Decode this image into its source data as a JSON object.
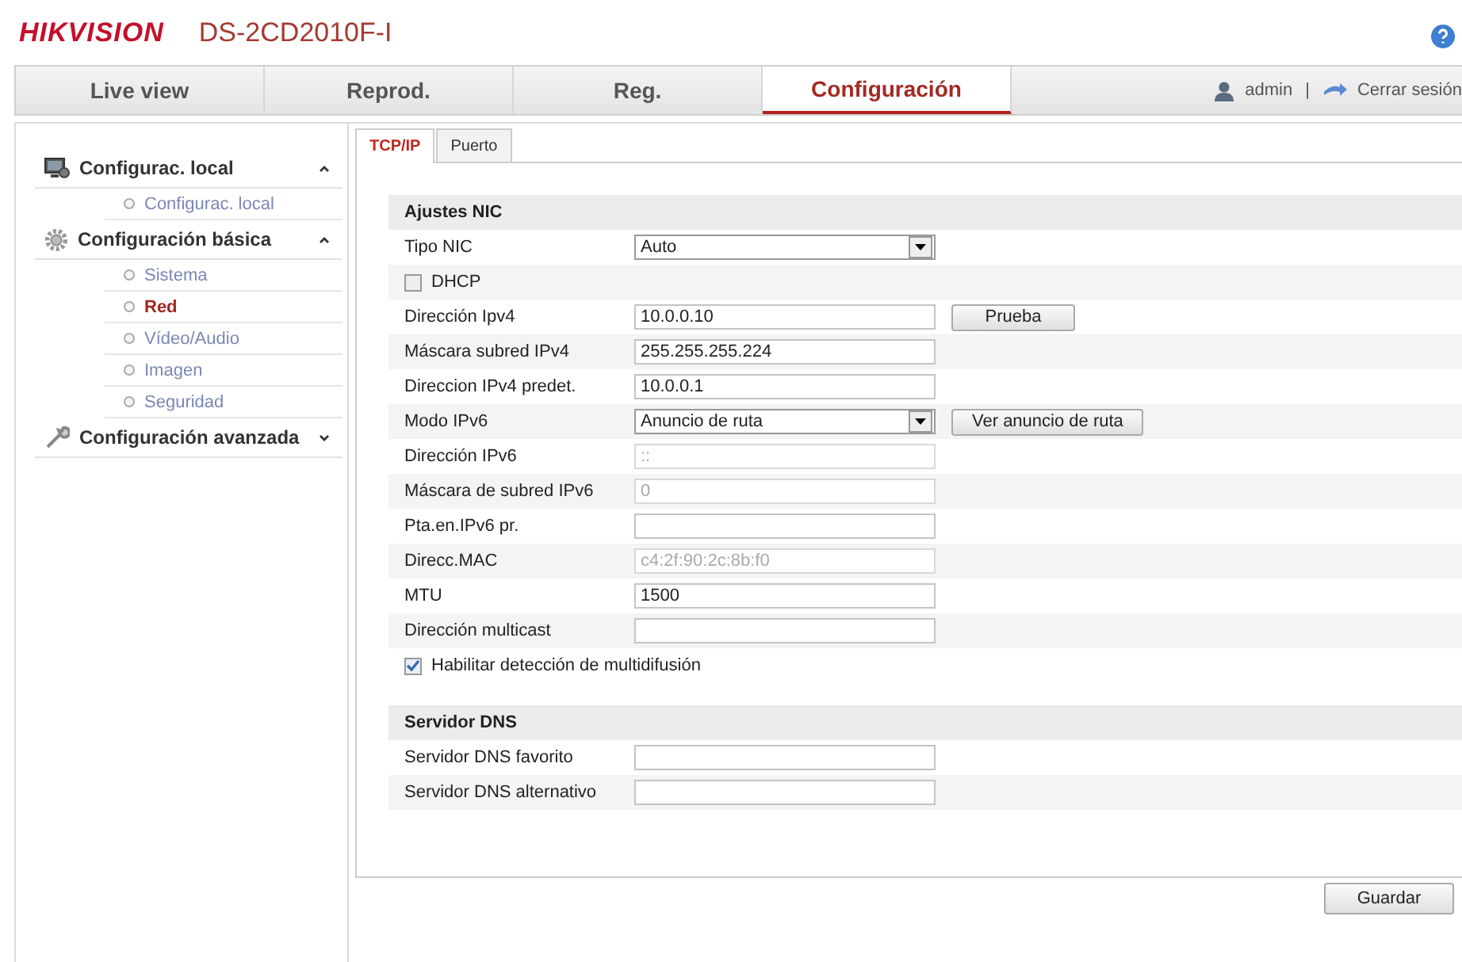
{
  "header": {
    "logo": "HIKVISION",
    "model": "DS-2CD2010F-I"
  },
  "nav": [
    {
      "label": "Live view",
      "selected": false
    },
    {
      "label": "Reprod.",
      "selected": false
    },
    {
      "label": "Reg.",
      "selected": false
    },
    {
      "label": "Configuración",
      "selected": true
    }
  ],
  "user": {
    "name": "admin",
    "separator": "|",
    "logout": "Cerrar sesión"
  },
  "sidebar": [
    {
      "title": "Configurac. local",
      "expanded": true,
      "items": [
        {
          "label": "Configurac. local",
          "selected": false
        }
      ]
    },
    {
      "title": "Configuración básica",
      "expanded": true,
      "items": [
        {
          "label": "Sistema",
          "selected": false
        },
        {
          "label": "Red",
          "selected": true
        },
        {
          "label": "Vídeo/Audio",
          "selected": false
        },
        {
          "label": "Imagen",
          "selected": false
        },
        {
          "label": "Seguridad",
          "selected": false
        }
      ]
    },
    {
      "title": "Configuración avanzada",
      "expanded": false
    }
  ],
  "subtabs": [
    {
      "label": "TCP/IP",
      "selected": true
    },
    {
      "label": "Puerto",
      "selected": false
    }
  ],
  "sections": [
    {
      "title": "Ajustes NIC",
      "rows": [
        {
          "kind": "select",
          "label": "Tipo NIC",
          "value": "Auto"
        },
        {
          "kind": "checkbox",
          "label": "DHCP",
          "checked": false
        },
        {
          "kind": "input",
          "label": "Dirección Ipv4",
          "value": "10.0.0.10",
          "disabled": false,
          "button": "Prueba"
        },
        {
          "kind": "input",
          "label": "Máscara subred IPv4",
          "value": "255.255.255.224",
          "disabled": false
        },
        {
          "kind": "input",
          "label": "Direccion IPv4 predet.",
          "value": "10.0.0.1",
          "disabled": false
        },
        {
          "kind": "select",
          "label": "Modo IPv6",
          "value": "Anuncio de ruta",
          "button": "Ver anuncio de ruta"
        },
        {
          "kind": "input",
          "label": "Dirección IPv6",
          "value": "::",
          "disabled": true
        },
        {
          "kind": "input",
          "label": "Máscara de subred IPv6",
          "value": "0",
          "disabled": true
        },
        {
          "kind": "input",
          "label": "Pta.en.IPv6 pr.",
          "value": ""
        },
        {
          "kind": "input",
          "label": "Direcc.MAC",
          "value": "c4:2f:90:2c:8b:f0",
          "disabled": true
        },
        {
          "kind": "input",
          "label": "MTU",
          "value": "1500",
          "disabled": false
        },
        {
          "kind": "input",
          "label": "Dirección multicast",
          "value": ""
        },
        {
          "kind": "checkbox",
          "label": "Habilitar detección de multidifusión",
          "checked": true
        }
      ]
    },
    {
      "title": "Servidor DNS",
      "rows": [
        {
          "kind": "input",
          "label": "Servidor DNS favorito",
          "value": ""
        },
        {
          "kind": "input",
          "label": "Servidor DNS alternativo",
          "value": ""
        }
      ]
    }
  ],
  "save": "Guardar"
}
